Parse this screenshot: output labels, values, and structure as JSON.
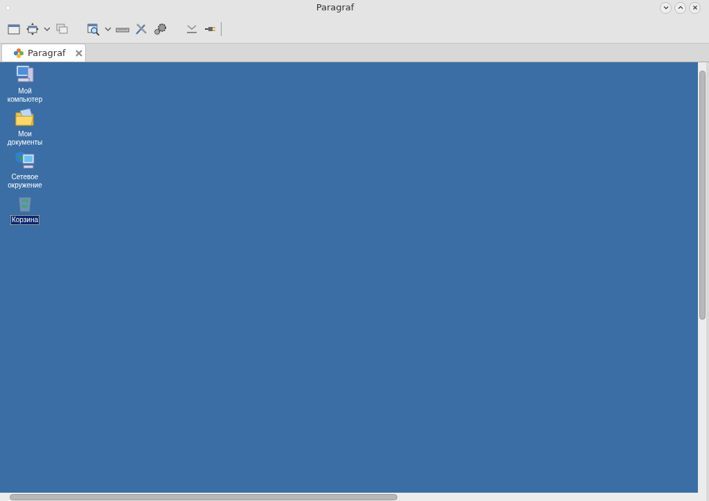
{
  "window": {
    "title": "Paragraf"
  },
  "tabs": [
    {
      "label": "Paragraf",
      "selected": true
    }
  ],
  "desktop_icons": [
    {
      "kind": "computer",
      "label": "Мой компьютер",
      "selected": false
    },
    {
      "kind": "documents",
      "label": "Мои документы",
      "selected": false
    },
    {
      "kind": "network",
      "label": "Сетевое окружение",
      "selected": false
    },
    {
      "kind": "recycle",
      "label": "Корзина",
      "selected": true
    }
  ]
}
